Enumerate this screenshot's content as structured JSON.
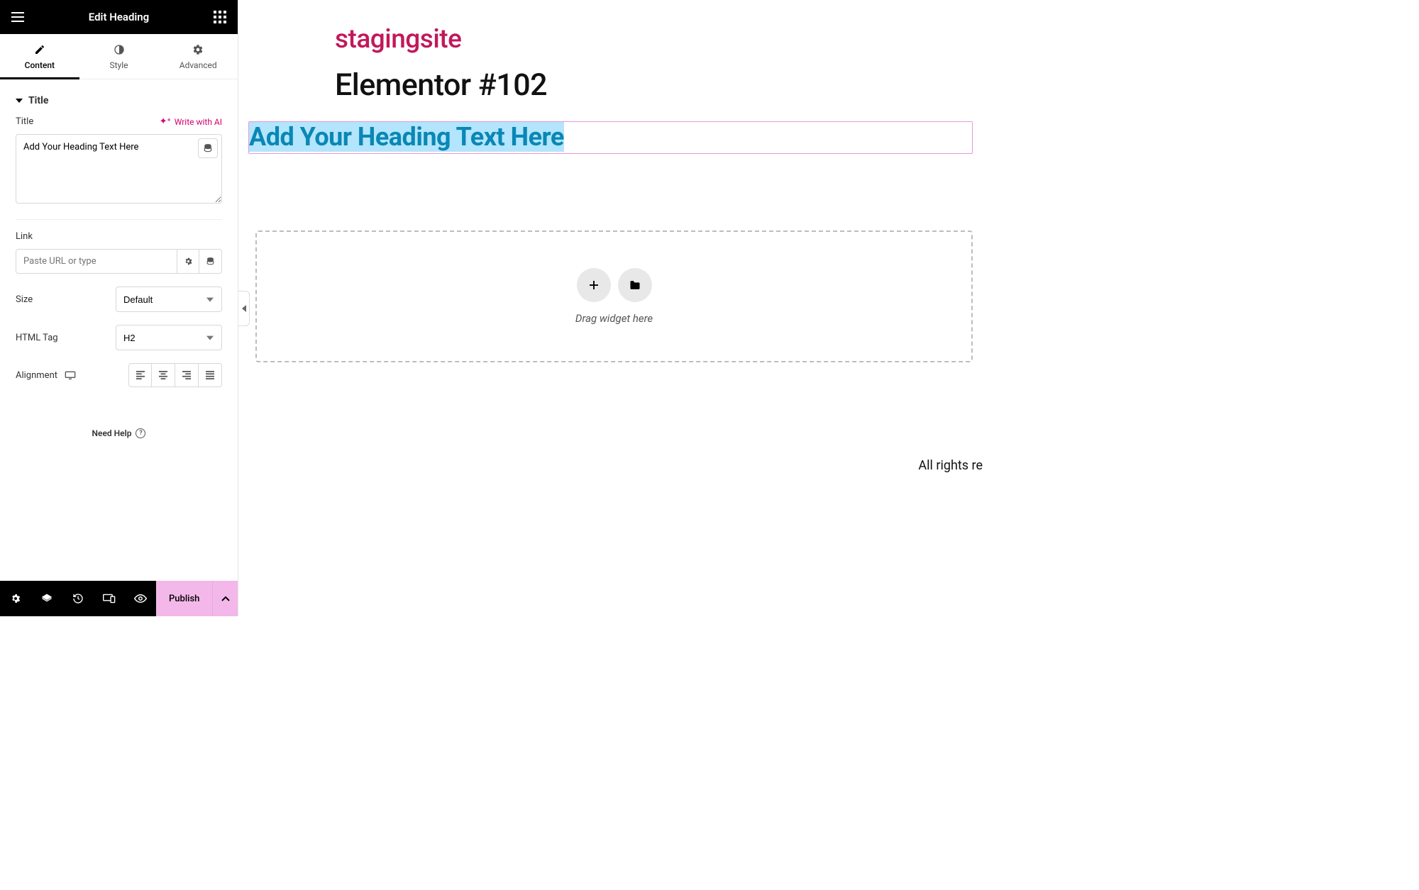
{
  "panel": {
    "title": "Edit Heading",
    "tabs": {
      "content": "Content",
      "style": "Style",
      "advanced": "Advanced"
    },
    "section_title": "Title",
    "controls": {
      "title_label": "Title",
      "write_with_ai": "Write with AI",
      "title_value": "Add Your Heading Text Here",
      "link_label": "Link",
      "link_placeholder": "Paste URL or type",
      "link_value": "",
      "size_label": "Size",
      "size_value": "Default",
      "htmltag_label": "HTML Tag",
      "htmltag_value": "H2",
      "alignment_label": "Alignment"
    },
    "need_help": "Need Help",
    "footer": {
      "publish": "Publish"
    }
  },
  "preview": {
    "site_name": "stagingsite",
    "page_title": "Elementor #102",
    "heading_text": "Add Your Heading Text Here",
    "dropzone_hint": "Drag widget here",
    "rights": "All rights re"
  }
}
